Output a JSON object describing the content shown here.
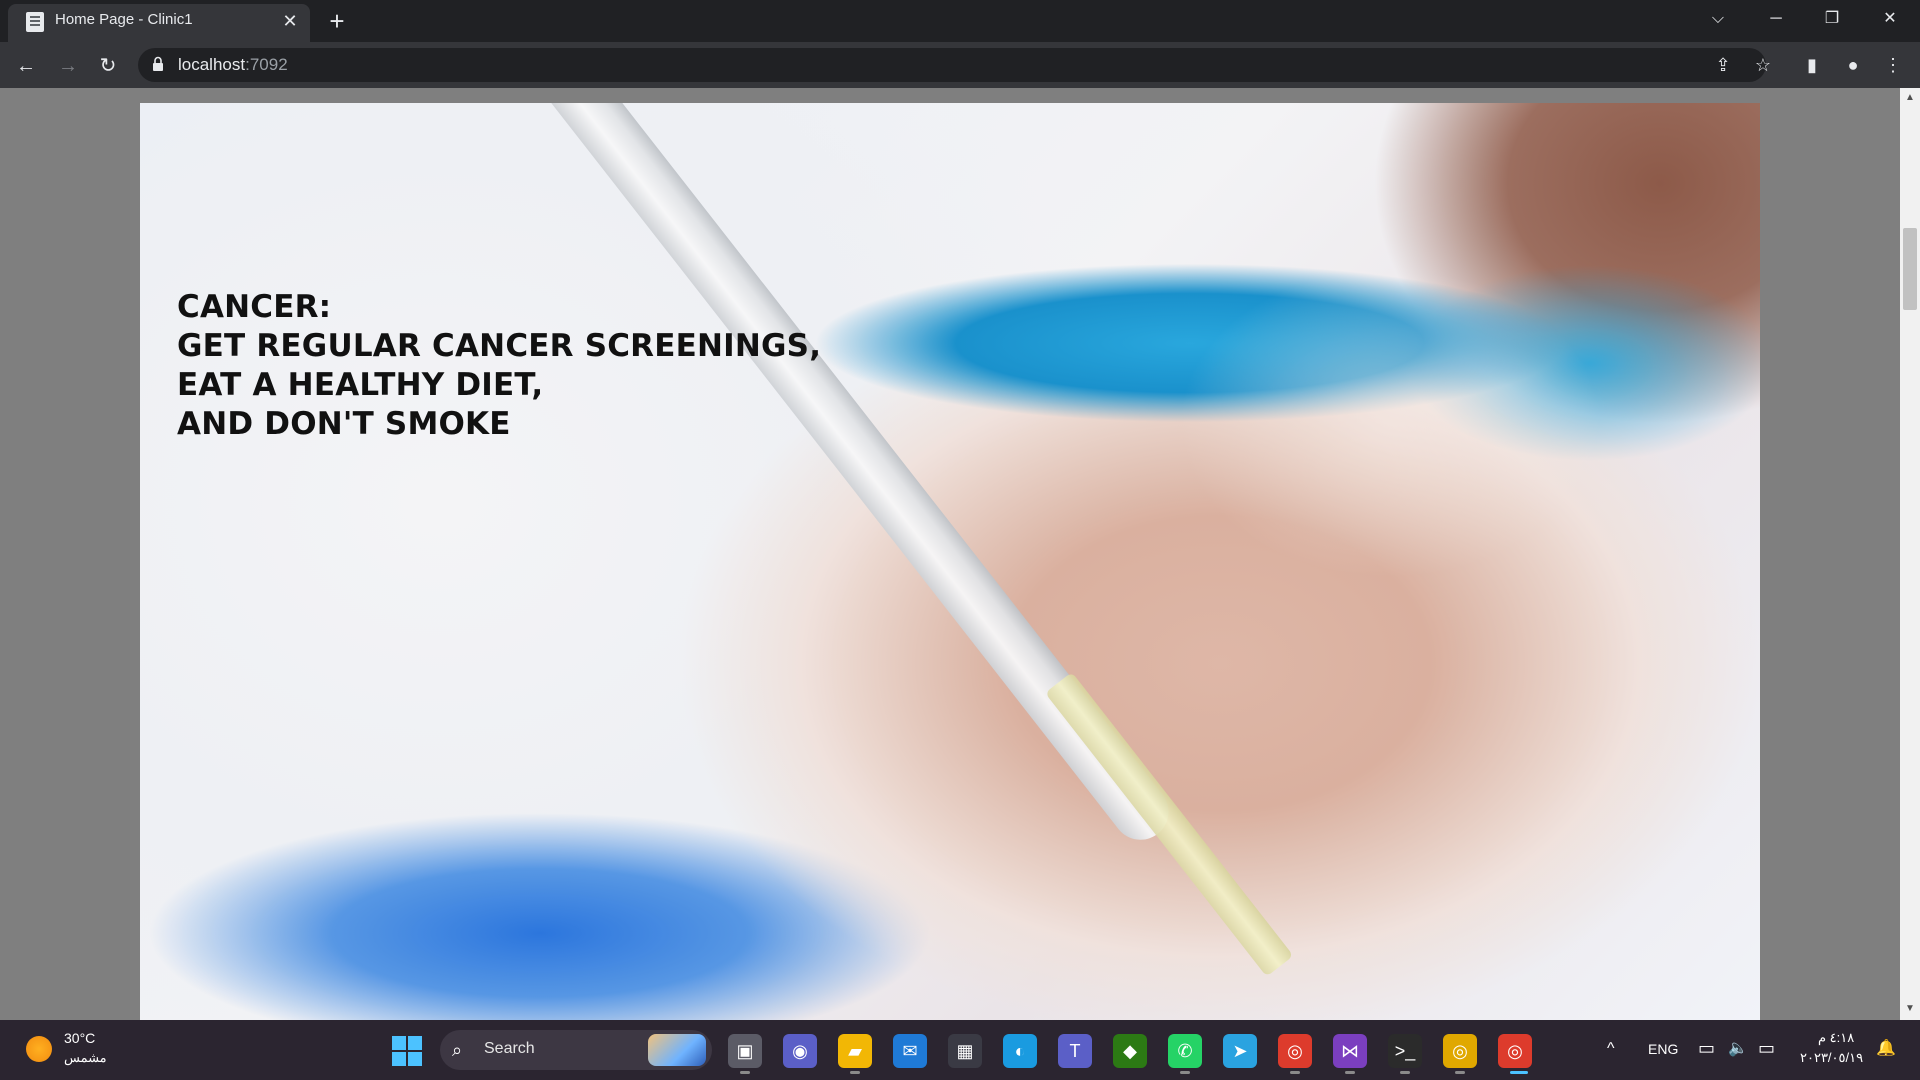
{
  "browser": {
    "tab_title": "Home Page - Clinic1",
    "tab_close": "✕",
    "new_tab": "+",
    "url_host": "localhost",
    "url_port": ":7092",
    "window_controls": {
      "dropdown": "⌵",
      "minimize": "─",
      "restore": "❐",
      "close": "✕"
    },
    "nav": {
      "back": "←",
      "forward": "→",
      "reload": "↻"
    },
    "toolbar_icons": {
      "share": "⇪",
      "bookmark": "☆",
      "sidepanel": "▮",
      "profile": "●",
      "menu": "⋮"
    }
  },
  "page": {
    "headline_lines": [
      "CANCER:",
      "GET REGULAR CANCER SCREENINGS,",
      "EAT A HEALTHY DIET,",
      "AND DON'T SMOKE"
    ]
  },
  "scrollbar": {
    "up": "▲",
    "down": "▼"
  },
  "taskbar": {
    "weather_temp": "30°C",
    "weather_cond": "مشمس",
    "search_label": "Search",
    "search_glyph": "⌕",
    "apps": [
      {
        "name": "task-view",
        "glyph": "▣",
        "color": "#5b5b66"
      },
      {
        "name": "meet",
        "glyph": "◉",
        "color": "#5b5fc7"
      },
      {
        "name": "file-explorer",
        "glyph": "▰",
        "color": "#f2b705"
      },
      {
        "name": "mail",
        "glyph": "✉",
        "color": "#1f7ad6"
      },
      {
        "name": "store",
        "glyph": "▦",
        "color": "#3a3a44"
      },
      {
        "name": "edge",
        "glyph": "◐",
        "color": "#1a9be0"
      },
      {
        "name": "teams",
        "glyph": "T",
        "color": "#5b5fc7"
      },
      {
        "name": "nvidia",
        "glyph": "◆",
        "color": "#2c7a14"
      },
      {
        "name": "whatsapp",
        "glyph": "✆",
        "color": "#25d366"
      },
      {
        "name": "telegram",
        "glyph": "➤",
        "color": "#2aa3e0"
      },
      {
        "name": "chrome",
        "glyph": "◎",
        "color": "#dd3b2c"
      },
      {
        "name": "visual-studio",
        "glyph": "⋈",
        "color": "#7b3fbf"
      },
      {
        "name": "terminal",
        "glyph": ">_",
        "color": "#2b2b2b"
      },
      {
        "name": "chrome-canary",
        "glyph": "◎",
        "color": "#e0a800"
      },
      {
        "name": "chrome-active",
        "glyph": "◎",
        "color": "#dd3b2c"
      }
    ],
    "tray_chevron": "^",
    "language": "ENG",
    "tray_icons": {
      "display": "▭",
      "volume": "🔈",
      "battery": "▭"
    },
    "time": "٤:١٨ م",
    "date": "٢٠٢٣/٠٥/١٩",
    "notification": "🔔"
  }
}
